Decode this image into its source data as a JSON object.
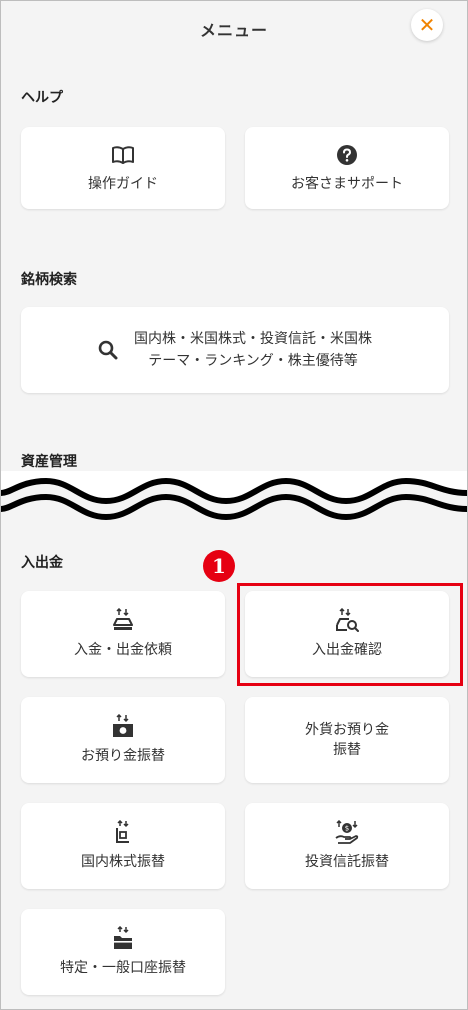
{
  "header": {
    "title": "メニュー",
    "close_symbol": "✕"
  },
  "sections": {
    "help": {
      "title": "ヘルプ",
      "items": [
        {
          "label": "操作ガイド",
          "icon": "book-icon"
        },
        {
          "label": "お客さまサポート",
          "icon": "question-icon"
        }
      ]
    },
    "search": {
      "title": "銘柄検索",
      "line1": "国内株・米国株式・投資信託・米国株",
      "line2": "テーマ・ランキング・株主優待等",
      "icon": "search-icon"
    },
    "assets": {
      "title": "資産管理"
    },
    "transfer": {
      "title": "入出金",
      "items": [
        {
          "label": "入金・出金依頼",
          "icon": "deposit-withdraw-icon"
        },
        {
          "label": "入出金確認",
          "icon": "deposit-confirm-icon"
        },
        {
          "label": "お預り金振替",
          "icon": "deposit-transfer-icon"
        },
        {
          "label_line1": "外貨お預り金",
          "label_line2": "振替"
        },
        {
          "label": "国内株式振替",
          "icon": "stock-transfer-icon"
        },
        {
          "label": "投資信託振替",
          "icon": "fund-transfer-icon"
        },
        {
          "label": "特定・一般口座振替",
          "icon": "account-transfer-icon"
        }
      ]
    }
  },
  "annotation": {
    "step_number": "1"
  },
  "colors": {
    "accent": "#f08300",
    "highlight": "#e60012",
    "background": "#f4f4f4",
    "card": "#ffffff"
  }
}
